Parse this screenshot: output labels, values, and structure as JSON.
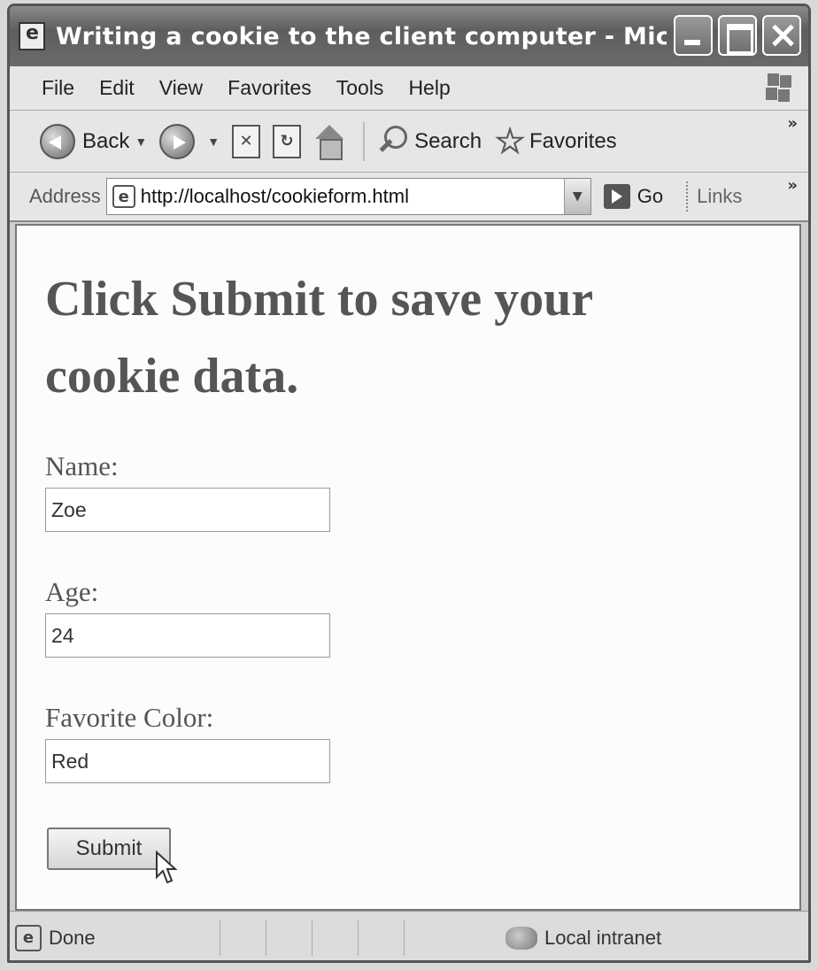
{
  "window": {
    "title": "Writing a cookie to the client computer - Micr..."
  },
  "menu": {
    "items": [
      "File",
      "Edit",
      "View",
      "Favorites",
      "Tools",
      "Help"
    ]
  },
  "toolbar": {
    "back_label": "Back",
    "search_label": "Search",
    "favorites_label": "Favorites",
    "overflow": "»"
  },
  "address": {
    "label": "Address",
    "url": "http://localhost/cookieform.html",
    "go_label": "Go",
    "links_label": "Links",
    "overflow": "»"
  },
  "page": {
    "heading": "Click Submit to save your cookie data.",
    "fields": [
      {
        "label": "Name:",
        "value": "Zoe"
      },
      {
        "label": "Age:",
        "value": "24"
      },
      {
        "label": "Favorite Color:",
        "value": "Red"
      }
    ],
    "submit_label": "Submit"
  },
  "status": {
    "text": "Done",
    "zone": "Local intranet"
  }
}
